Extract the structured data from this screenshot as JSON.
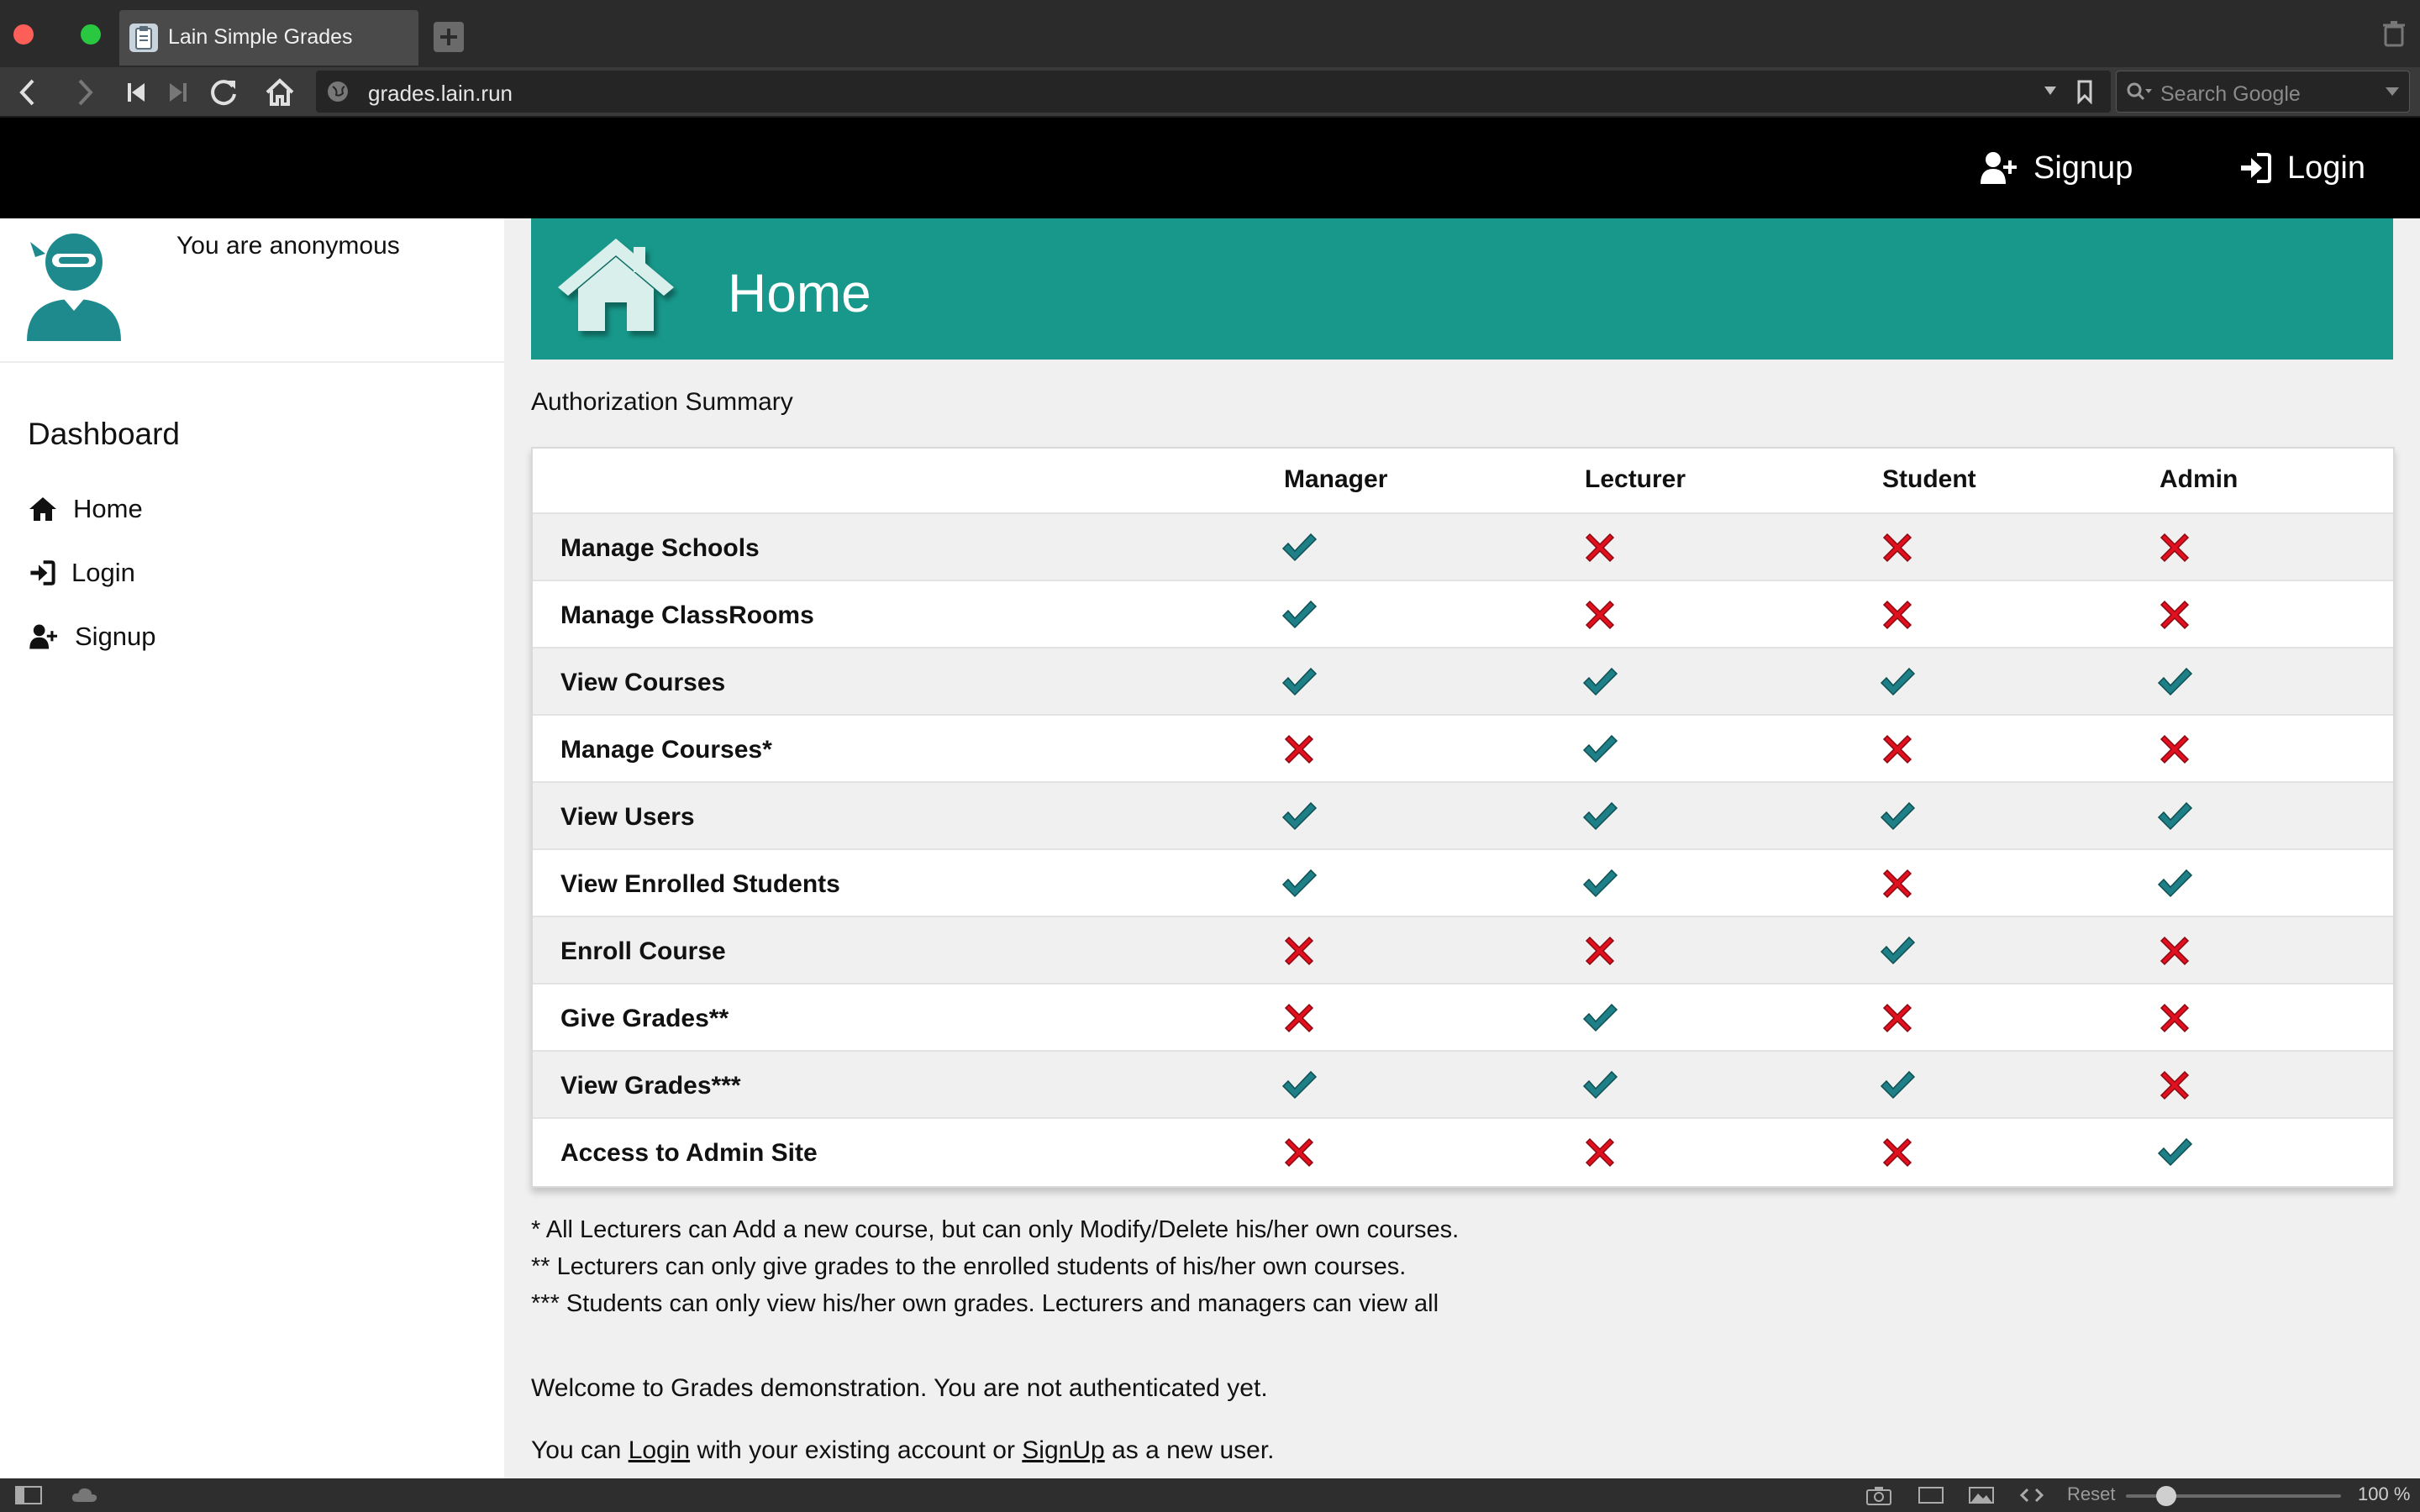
{
  "browser": {
    "tab_title": "Lain Simple Grades",
    "url": "grades.lain.run",
    "search_placeholder": "Search Google",
    "zoom": "100 %",
    "reset_label": "Reset"
  },
  "header": {
    "signup_label": "Signup",
    "login_label": "Login"
  },
  "sidebar": {
    "user_status": "You are anonymous",
    "section_title": "Dashboard",
    "items": [
      {
        "label": "Home",
        "icon": "home-icon"
      },
      {
        "label": "Login",
        "icon": "sign-in-icon"
      },
      {
        "label": "Signup",
        "icon": "user-plus-icon"
      }
    ]
  },
  "banner": {
    "title": "Home",
    "icon": "house-icon",
    "color": "#17988a"
  },
  "auth": {
    "title": "Authorization Summary",
    "columns": [
      "Manager",
      "Lecturer",
      "Student",
      "Admin"
    ],
    "rows": [
      {
        "label": "Manage Schools",
        "values": [
          true,
          false,
          false,
          false
        ]
      },
      {
        "label": "Manage ClassRooms",
        "values": [
          true,
          false,
          false,
          false
        ]
      },
      {
        "label": "View Courses",
        "values": [
          true,
          true,
          true,
          true
        ]
      },
      {
        "label": "Manage Courses*",
        "values": [
          false,
          true,
          false,
          false
        ]
      },
      {
        "label": "View Users",
        "values": [
          true,
          true,
          true,
          true
        ]
      },
      {
        "label": "View Enrolled Students",
        "values": [
          true,
          true,
          false,
          true
        ]
      },
      {
        "label": "Enroll Course",
        "values": [
          false,
          false,
          true,
          false
        ]
      },
      {
        "label": "Give Grades**",
        "values": [
          false,
          true,
          false,
          false
        ]
      },
      {
        "label": "View Grades***",
        "values": [
          true,
          true,
          true,
          false
        ]
      },
      {
        "label": "Access to Admin Site",
        "values": [
          false,
          false,
          false,
          true
        ]
      }
    ],
    "check_color": "#1f7f86",
    "cross_color": "#e0101e"
  },
  "notes": [
    "* All Lecturers can Add a new course, but can only Modify/Delete his/her own courses.",
    "** Lecturers can only give grades to the enrolled students of his/her own courses.",
    "*** Students can only view his/her own grades. Lecturers and managers can view all"
  ],
  "welcome": "Welcome to Grades demonstration. You are not authenticated yet.",
  "cta": {
    "prefix": "You can",
    "login_link": "Login",
    "middle": "with your existing account or",
    "signup_link": "SignUp",
    "suffix": "as a new user."
  }
}
